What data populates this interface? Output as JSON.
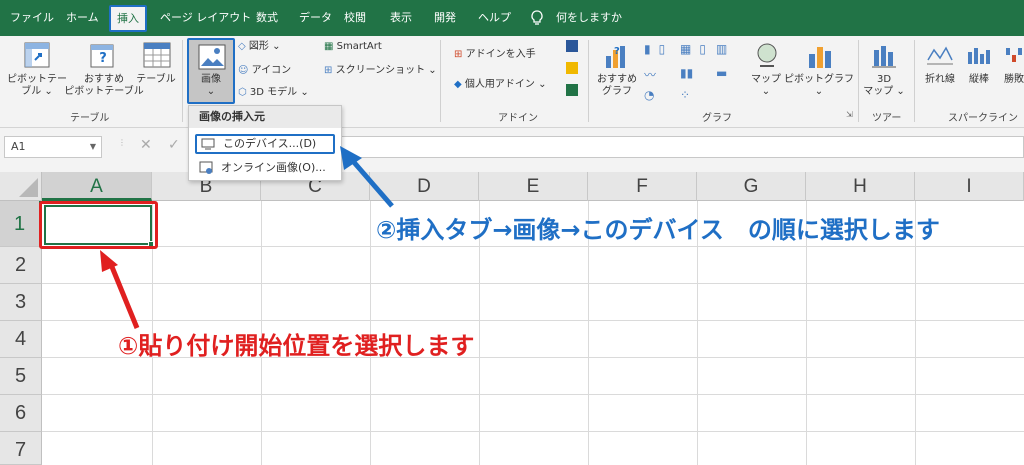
{
  "tabs": [
    "ファイル",
    "ホーム",
    "挿入",
    "ページ レイアウト",
    "数式",
    "データ",
    "校閲",
    "表示",
    "開発",
    "ヘルプ"
  ],
  "tell_me": "何をしますか",
  "ribbon": {
    "pivot_table": [
      "ピボットテー",
      "ブル ⌄"
    ],
    "recommended_pivot": [
      "おすすめ",
      "ピボットテーブル"
    ],
    "table": "テーブル",
    "group_table": "テーブル",
    "images": [
      "画像",
      "⌄"
    ],
    "shapes": "図形 ⌄",
    "icons": "アイコン",
    "model3d": "3D モデル ⌄",
    "smartart": "SmartArt",
    "screenshot": "スクリーンショット ⌄",
    "get_addins": "アドインを入手",
    "my_addins": "個人用アドイン",
    "group_addins": "アドイン",
    "recommended_charts": [
      "おすすめ",
      "グラフ"
    ],
    "maps": [
      "マップ",
      "⌄"
    ],
    "pivot_chart": [
      "ピボットグラフ",
      "⌄"
    ],
    "group_charts": "グラフ",
    "map3d": [
      "3D",
      "マップ ⌄"
    ],
    "group_tours": "ツアー",
    "line": "折れ線",
    "column": "縦棒",
    "winloss": "勝敗",
    "group_sparklines": "スパークライン"
  },
  "dropdown": {
    "header": "画像の挿入元",
    "this_device": "このデバイス...(D)",
    "online": "オンライン画像(O)..."
  },
  "formula_bar": {
    "name_box": "A1",
    "cancel": "✕",
    "confirm": "✓"
  },
  "columns": [
    "A",
    "B",
    "C",
    "D",
    "E",
    "F",
    "G",
    "H",
    "I"
  ],
  "rows": [
    "1",
    "2",
    "3",
    "4",
    "5",
    "6",
    "7"
  ],
  "annotations": {
    "step1": "①貼り付け開始位置を選択します",
    "step2": "②挿入タブ→画像→このデバイス　の順に選択します"
  },
  "colors": {
    "excel_green": "#217346",
    "annot_red": "#e02020",
    "annot_blue": "#1f6fc5"
  }
}
